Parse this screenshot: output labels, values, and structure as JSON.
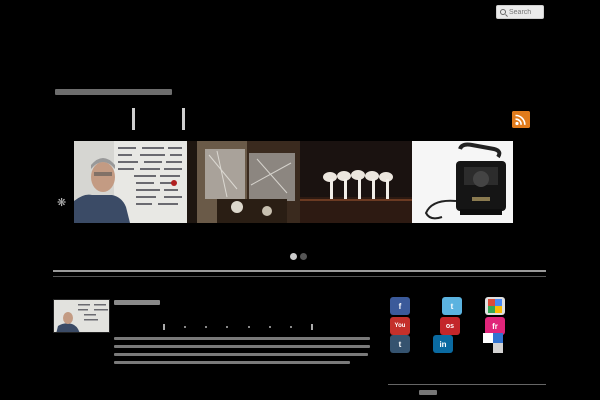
{
  "search": {
    "placeholder": "Search"
  },
  "header": {
    "site_title": ""
  },
  "gallery": {
    "slides": [
      {
        "name": "man-in-front-of-whiteboard"
      },
      {
        "name": "shop-window-interior"
      },
      {
        "name": "stretching-people-on-stage"
      },
      {
        "name": "antique-telephone"
      }
    ],
    "active_dot": 0,
    "dot_count": 2
  },
  "post": {
    "title": "",
    "subtitle": "",
    "excerpt_lines": 4
  },
  "social": {
    "icons": [
      {
        "name": "facebook-icon",
        "label": "f",
        "color": "#3b5a9a"
      },
      {
        "name": "twitter-icon",
        "label": "t",
        "color": "#5bb3e0"
      },
      {
        "name": "google-icon",
        "label": "g",
        "color": "#e0e0e0"
      },
      {
        "name": "youtube-icon",
        "label": "You",
        "color": "#c4302b"
      },
      {
        "name": "lastfm-icon",
        "label": "os",
        "color": "#c3262a"
      },
      {
        "name": "friendfeed-icon",
        "label": "fr",
        "color": "#e0257a"
      },
      {
        "name": "tumblr-icon",
        "label": "t",
        "color": "#35536f"
      },
      {
        "name": "linkedin-icon",
        "label": "in",
        "color": "#0a6aa1"
      },
      {
        "name": "delicious-icon",
        "label": "",
        "color": "#ffffff"
      }
    ],
    "widget_title": ""
  },
  "colors": {
    "background": "#000000",
    "rss": "#e07b1c"
  }
}
